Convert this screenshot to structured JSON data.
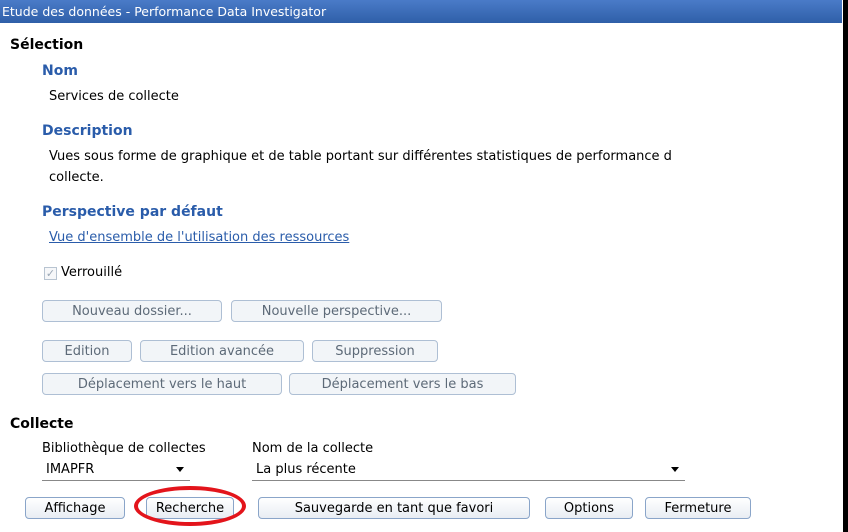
{
  "window": {
    "title": "Etude des données - Performance Data Investigator"
  },
  "selection": {
    "heading": "Sélection",
    "name_label": "Nom",
    "name_value": "Services de collecte",
    "description_label": "Description",
    "description_line1": "Vues sous forme de graphique et de table portant sur différentes statistiques de performance d",
    "description_line2": "collecte.",
    "default_perspective_label": "Perspective par défaut",
    "default_perspective_link": "Vue d'ensemble de l'utilisation des ressources",
    "locked_label": "Verrouillé",
    "locked_checked": true,
    "buttons": {
      "new_folder": "Nouveau dossier...",
      "new_perspective": "Nouvelle perspective...",
      "edit": "Edition",
      "advanced_edit": "Edition avancée",
      "delete": "Suppression",
      "move_up": "Déplacement vers le haut",
      "move_down": "Déplacement vers le bas"
    }
  },
  "collection": {
    "heading": "Collecte",
    "library_label": "Bibliothèque de collectes",
    "library_value": "IMAPFR",
    "name_label": "Nom de la collecte",
    "name_value": "La plus récente"
  },
  "actions": {
    "display": "Affichage",
    "search": "Recherche",
    "save_favorite": "Sauvegarde en tant que favori",
    "options": "Options",
    "close": "Fermeture"
  },
  "colors": {
    "title_bar": "#2f5fa8",
    "subhead": "#2a5caa",
    "highlight_circle": "#e3141b"
  }
}
